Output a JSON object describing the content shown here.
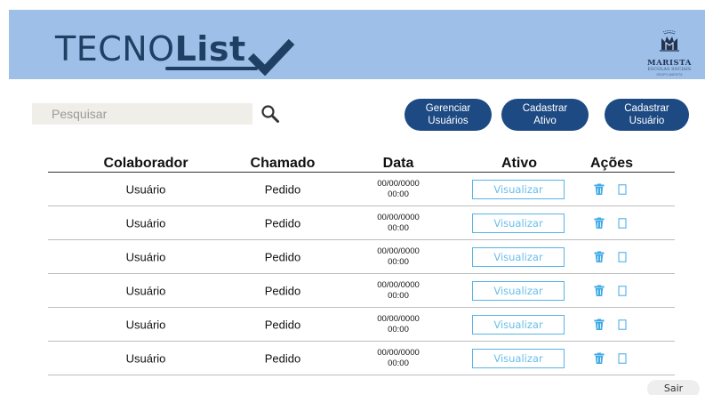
{
  "header": {
    "logo": {
      "prefix": "TECNO",
      "emphasis": "List"
    },
    "brand": {
      "name": "MARISTA",
      "sub": "ESCOLAS SOCIAIS",
      "group": "GRUPO MARISTA"
    },
    "accent": "#1f3f63",
    "background": "#9dbfe8"
  },
  "search": {
    "placeholder": "Pesquisar",
    "value": "",
    "icon": "search-icon"
  },
  "toolbar": {
    "manage_users": "Gerenciar\nUsuários",
    "register_asset": "Cadastrar\nAtivo",
    "register_user": "Cadastrar\nUsuário",
    "button_color": "#1d4a83"
  },
  "table": {
    "columns": [
      "Colaborador",
      "Chamado",
      "Data",
      "Ativo",
      "Ações"
    ],
    "rows": [
      {
        "user": "Usuário",
        "ticket": "Pedido",
        "date": "00/00/0000",
        "time": "00:00",
        "asset": "Visualizar"
      },
      {
        "user": "Usuário",
        "ticket": "Pedido",
        "date": "00/00/0000",
        "time": "00:00",
        "asset": "Visualizar"
      },
      {
        "user": "Usuário",
        "ticket": "Pedido",
        "date": "00/00/0000",
        "time": "00:00",
        "asset": "Visualizar"
      },
      {
        "user": "Usuário",
        "ticket": "Pedido",
        "date": "00/00/0000",
        "time": "00:00",
        "asset": "Visualizar"
      },
      {
        "user": "Usuário",
        "ticket": "Pedido",
        "date": "00/00/0000",
        "time": "00:00",
        "asset": "Visualizar"
      },
      {
        "user": "Usuário",
        "ticket": "Pedido",
        "date": "00/00/0000",
        "time": "00:00",
        "asset": "Visualizar"
      }
    ],
    "action_icons": [
      "trash-icon",
      "bookmark-icon"
    ],
    "action_color": "#3fa9e6"
  },
  "footer": {
    "exit_label": "Sair"
  }
}
